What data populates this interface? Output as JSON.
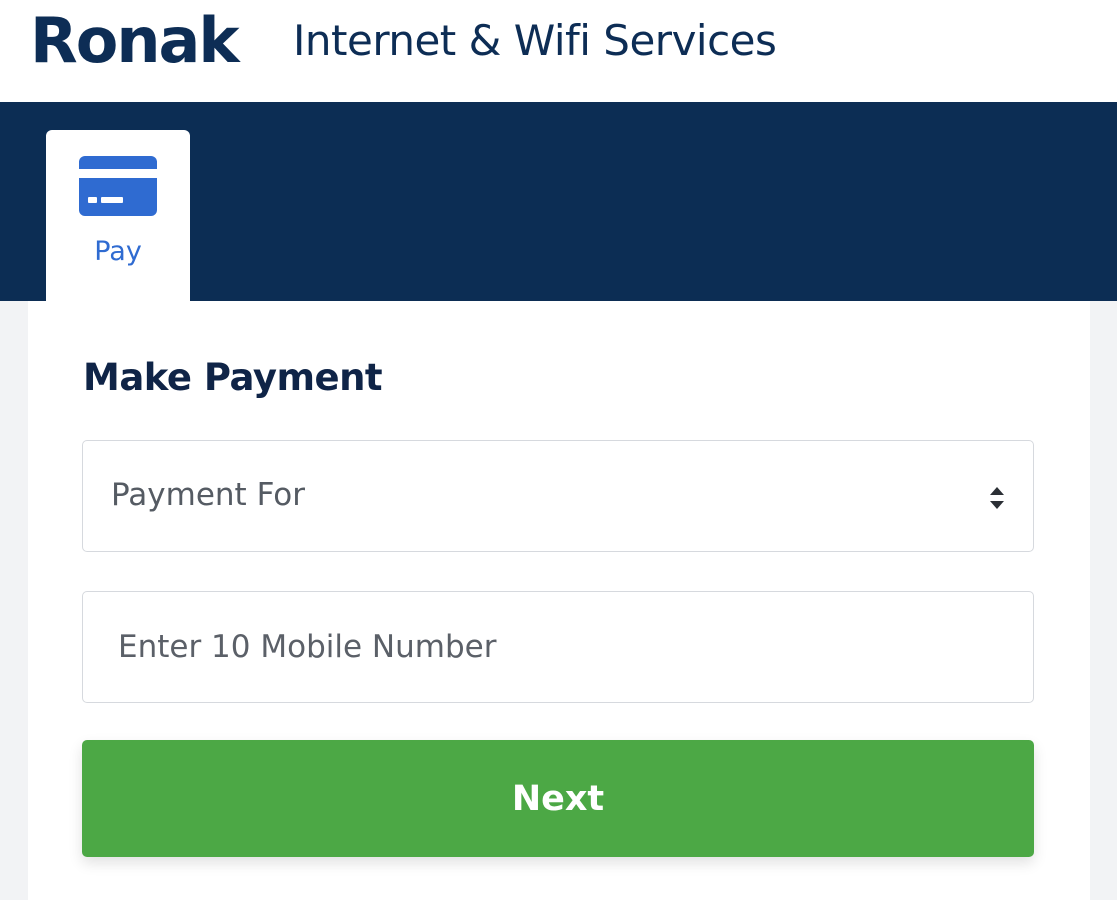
{
  "header": {
    "brand": "Ronak",
    "tagline": "Internet & Wifi Services"
  },
  "nav": {
    "tabs": [
      {
        "label": "Pay",
        "icon": "credit-card-icon"
      }
    ]
  },
  "form": {
    "title": "Make Payment",
    "payment_for_select": {
      "selected": "Payment For"
    },
    "mobile_input": {
      "placeholder": "Enter 10 Mobile Number",
      "value": ""
    },
    "next_label": "Next"
  },
  "colors": {
    "navy": "#0c2d54",
    "accent_blue": "#2f6bd1",
    "button_green": "#4ca845"
  }
}
